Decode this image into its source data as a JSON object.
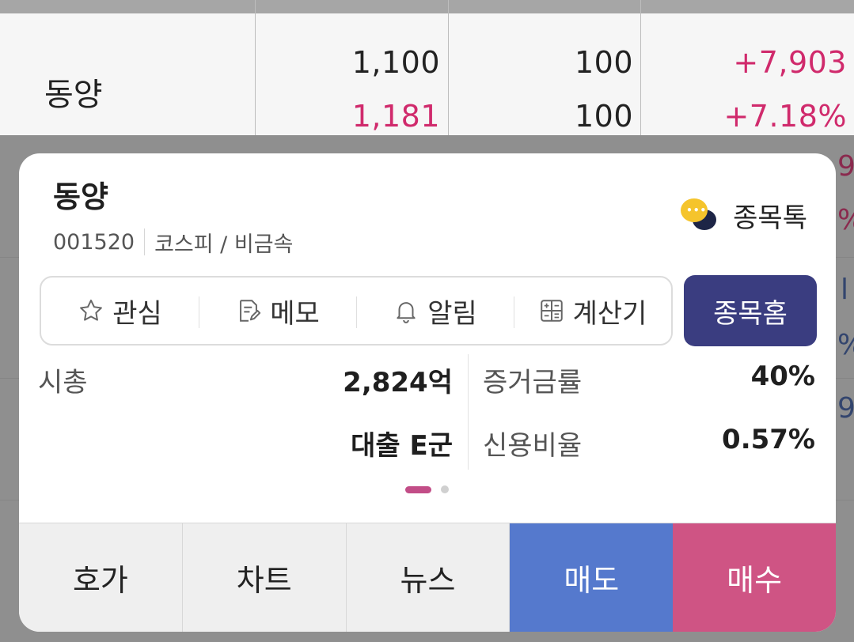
{
  "list_row": {
    "name": "동양",
    "price": "1,100",
    "expected_price": "1,181",
    "qty_1": "100",
    "qty_2": "100",
    "change_value": "+7,903",
    "change_pct": "+7.18%"
  },
  "background_peek": [
    "9",
    "%",
    "l",
    "%",
    "9"
  ],
  "popup": {
    "stock_name": "동양",
    "code": "001520",
    "market_sector": "코스피 / 비금속",
    "talk_label": "종목톡",
    "actions": [
      {
        "label": "관심",
        "icon": "star-icon"
      },
      {
        "label": "메모",
        "icon": "memo-icon"
      },
      {
        "label": "알림",
        "icon": "bell-icon"
      },
      {
        "label": "계산기",
        "icon": "calculator-icon"
      }
    ],
    "home_button": "종목홈",
    "info": {
      "market_cap_label": "시총",
      "market_cap_value": "2,824억",
      "loan_value": "대출 E군",
      "margin_rate_label": "증거금률",
      "margin_rate_value": "40%",
      "credit_ratio_label": "신용비율",
      "credit_ratio_value": "0.57%"
    },
    "pager": {
      "current": 1,
      "total": 2
    },
    "tabs": [
      "호가",
      "차트",
      "뉴스",
      "매도",
      "매수"
    ]
  },
  "colors": {
    "up_red": "#d02a6c",
    "home_navy": "#3a3d80",
    "sell_blue": "#5579cd",
    "buy_pink": "#cf5484"
  }
}
